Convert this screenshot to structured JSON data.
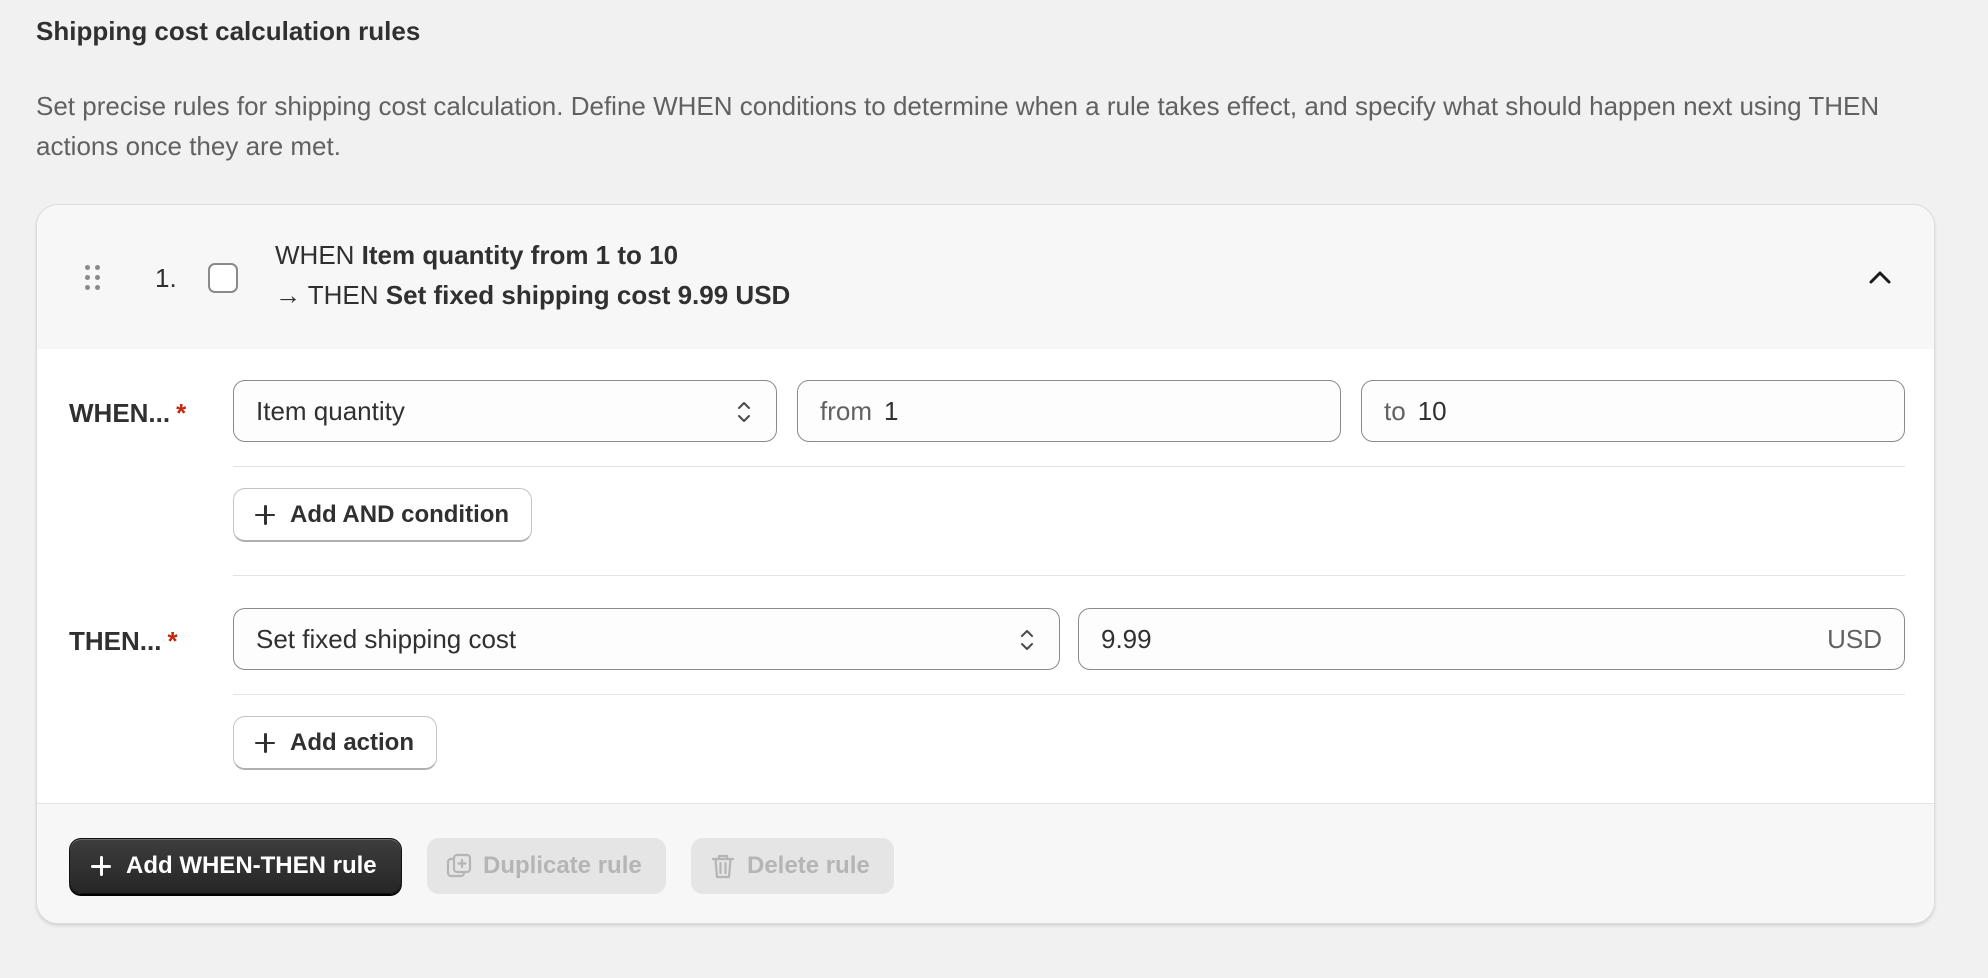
{
  "page": {
    "title": "Shipping cost calculation rules",
    "description": "Set precise rules for shipping cost calculation. Define WHEN conditions to determine when a rule takes effect, and specify what should happen next using THEN actions once they are met."
  },
  "rule": {
    "index": "1.",
    "checked": false,
    "summary": {
      "when_keyword": "WHEN",
      "when_text": "Item quantity from 1 to 10",
      "arrow": "→",
      "then_keyword": "THEN",
      "then_text": "Set fixed shipping cost 9.99 USD"
    },
    "when": {
      "label": "WHEN...",
      "required_mark": "*",
      "condition": {
        "field": "Item quantity",
        "from_prefix": "from",
        "from_value": "1",
        "to_prefix": "to",
        "to_value": "10"
      },
      "add_button": "Add AND condition"
    },
    "then": {
      "label": "THEN...",
      "required_mark": "*",
      "action": {
        "type": "Set fixed shipping cost",
        "value": "9.99",
        "currency": "USD"
      },
      "add_button": "Add action"
    }
  },
  "footer": {
    "add_rule": "Add WHEN-THEN rule",
    "duplicate_rule": "Duplicate rule",
    "delete_rule": "Delete rule"
  },
  "icons": {
    "drag": "drag-handle-icon",
    "collapse": "chevron-up-icon",
    "select": "select-arrows-icon",
    "plus": "plus-icon",
    "duplicate": "duplicate-icon",
    "delete": "trash-icon"
  },
  "colors": {
    "required": "#c5280c",
    "primary_button": "#303030",
    "background": "#f1f1f1"
  }
}
